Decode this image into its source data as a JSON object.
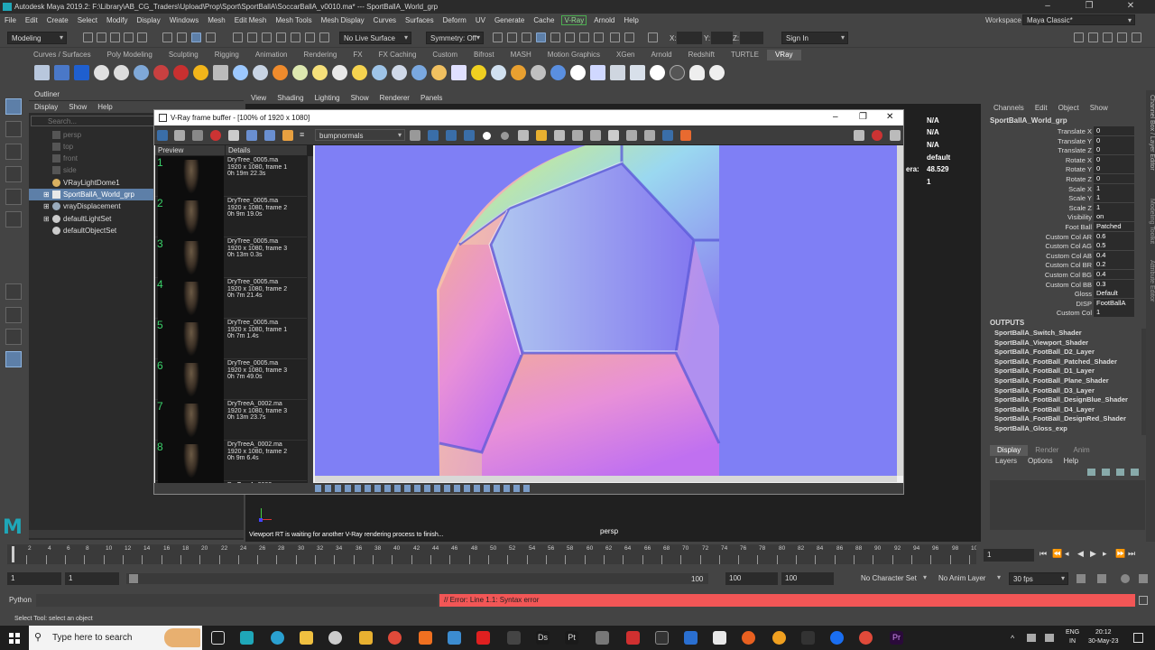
{
  "window": {
    "title": "Autodesk Maya 2019.2: F:\\Library\\AB_CG_Traders\\Upload\\Prop\\Sport\\SportBallA\\SoccarBallA_v0010.ma*   ---   SportBallA_World_grp",
    "controls": [
      "–",
      "❐",
      "✕"
    ]
  },
  "menubar": [
    "File",
    "Edit",
    "Create",
    "Select",
    "Modify",
    "Display",
    "Windows",
    "Mesh",
    "Edit Mesh",
    "Mesh Tools",
    "Mesh Display",
    "Curves",
    "Surfaces",
    "Deform",
    "UV",
    "Generate",
    "Cache",
    "V-Ray",
    "Arnold",
    "Help"
  ],
  "workspace": {
    "label": "Workspace :",
    "value": "Maya Classic*"
  },
  "statusline": {
    "mode": "Modeling",
    "live_surface": "No Live Surface",
    "symmetry": "Symmetry: Off",
    "x_label": "X:",
    "y_label": "Y:",
    "z_label": "Z:",
    "signin": "Sign In"
  },
  "shelf_tabs": [
    "Curves / Surfaces",
    "Poly Modeling",
    "Sculpting",
    "Rigging",
    "Animation",
    "Rendering",
    "FX",
    "FX Caching",
    "Custom",
    "Bifrost",
    "MASH",
    "Motion Graphics",
    "XGen",
    "Arnold",
    "Redshift",
    "TURTLE",
    "VRay"
  ],
  "shelf_active": "VRay",
  "outliner": {
    "title": "Outliner",
    "menu": [
      "Display",
      "Show",
      "Help"
    ],
    "search_placeholder": "Search...",
    "items": [
      "persp",
      "top",
      "front",
      "side",
      "VRayLightDome1",
      "SportBallA_World_grp",
      "vrayDisplacement",
      "defaultLightSet",
      "defaultObjectSet"
    ]
  },
  "viewport": {
    "menu": [
      "View",
      "Shading",
      "Lighting",
      "Show",
      "Renderer",
      "Panels"
    ],
    "hud": [
      "N/A",
      "N/A",
      "N/A",
      "default",
      "48.529",
      "1"
    ],
    "hud_label": "era:",
    "camera": "persp",
    "message": "Viewport RT is waiting for another V-Ray rendering process to finish..."
  },
  "vfb": {
    "title": "V-Ray frame buffer - [100% of 1920 x 1080]",
    "channel": "bumpnormals",
    "history_headers": [
      "Preview",
      "Details"
    ],
    "history": [
      {
        "n": "1",
        "file": "DryTree_0005.ma",
        "res": "1920 x 1080, frame 1",
        "time": "0h 19m 22.3s"
      },
      {
        "n": "2",
        "file": "DryTree_0005.ma",
        "res": "1920 x 1080, frame 2",
        "time": "0h 9m 19.0s"
      },
      {
        "n": "3",
        "file": "DryTree_0005.ma",
        "res": "1920 x 1080, frame 3",
        "time": "0h 13m 0.3s"
      },
      {
        "n": "4",
        "file": "DryTree_0005.ma",
        "res": "1920 x 1080, frame 2",
        "time": "0h 7m 21.4s"
      },
      {
        "n": "5",
        "file": "DryTree_0005.ma",
        "res": "1920 x 1080, frame 1",
        "time": "0h 7m 1.4s"
      },
      {
        "n": "6",
        "file": "DryTree_0005.ma",
        "res": "1920 x 1080, frame 3",
        "time": "0h 7m 49.0s"
      },
      {
        "n": "7",
        "file": "DryTreeA_0002.ma",
        "res": "1920 x 1080, frame 3",
        "time": "0h 13m 23.7s"
      },
      {
        "n": "8",
        "file": "DryTreeA_0002.ma",
        "res": "1920 x 1080, frame 2",
        "time": "0h 9m 6.4s"
      },
      {
        "n": "9",
        "file": "DryTreeA_0002.ma",
        "res": "",
        "time": ""
      }
    ]
  },
  "channelbox": {
    "menu": [
      "Channels",
      "Edit",
      "Object",
      "Show"
    ],
    "object": "SportBallA_World_grp",
    "attrs": [
      {
        "k": "Translate X",
        "v": "0"
      },
      {
        "k": "Translate Y",
        "v": "0"
      },
      {
        "k": "Translate Z",
        "v": "0"
      },
      {
        "k": "Rotate X",
        "v": "0"
      },
      {
        "k": "Rotate Y",
        "v": "0"
      },
      {
        "k": "Rotate Z",
        "v": "0"
      },
      {
        "k": "Scale X",
        "v": "1"
      },
      {
        "k": "Scale Y",
        "v": "1"
      },
      {
        "k": "Scale Z",
        "v": "1"
      },
      {
        "k": "Visibility",
        "v": "on"
      },
      {
        "k": "Foot Ball",
        "v": "Patched"
      },
      {
        "k": "Custom Col AR",
        "v": "0.6"
      },
      {
        "k": "Custom Col AG",
        "v": "0.5"
      },
      {
        "k": "Custom Col AB",
        "v": "0.4"
      },
      {
        "k": "Custom Col BR",
        "v": "0.2"
      },
      {
        "k": "Custom Col BG",
        "v": "0.4"
      },
      {
        "k": "Custom Col BB",
        "v": "0.3"
      },
      {
        "k": "Gloss",
        "v": "Default"
      },
      {
        "k": "DISP",
        "v": "FootBallA"
      },
      {
        "k": "Custom Col",
        "v": "1"
      }
    ],
    "outputs_label": "OUTPUTS",
    "outputs": [
      "SportBallA_Switch_Shader",
      "SportBallA_Viewport_Shader",
      "SportBallA_FootBall_D2_Layer",
      "SportBallA_FootBall_Patched_Shader",
      "SportBallA_FootBall_D1_Layer",
      "SportBallA_FootBall_Plane_Shader",
      "SportBallA_FootBall_D3_Layer",
      "SportBallA_FootBall_DesignBlue_Shader",
      "SportBallA_FootBall_D4_Layer",
      "SportBallA_FootBall_DesignRed_Shader",
      "SportBallA_Gloss_exp"
    ],
    "side_tabs": [
      "Channel Box / Layer Editor",
      "Modeling Toolkit",
      "Attribute Editor"
    ]
  },
  "layers": {
    "tabs": [
      "Display",
      "Render",
      "Anim"
    ],
    "menu": [
      "Layers",
      "Options",
      "Help"
    ]
  },
  "timeline": {
    "ticks": [
      "2",
      "4",
      "6",
      "8",
      "10",
      "12",
      "14",
      "16",
      "18",
      "20",
      "22",
      "24",
      "26",
      "28",
      "30",
      "32",
      "34",
      "36",
      "38",
      "40",
      "42",
      "44",
      "46",
      "48",
      "50",
      "52",
      "54",
      "56",
      "58",
      "60",
      "62",
      "64",
      "66",
      "68",
      "70",
      "72",
      "74",
      "76",
      "78",
      "80",
      "82",
      "84",
      "86",
      "88",
      "90",
      "92",
      "94",
      "96",
      "98",
      "100"
    ],
    "current": "1",
    "start": "1",
    "inner_start": "1",
    "inner_end": "100",
    "end_a": "100",
    "end_b": "100",
    "character_set": "No Character Set",
    "anim_layer": "No Anim Layer",
    "fps": "30 fps"
  },
  "command": {
    "lang": "Python",
    "error": "// Error: Line 1.1: Syntax error"
  },
  "status_help": "Select Tool: select an object",
  "taskbar": {
    "search": "Type here to search",
    "lang": "ENG",
    "region": "IN",
    "time": "20:12",
    "date": "30-May-23"
  },
  "colors": {
    "accent": "#5d7fa8",
    "error": "#f25656",
    "maya_teal": "#1fa7b8",
    "vray_green": "#3bd36b"
  }
}
